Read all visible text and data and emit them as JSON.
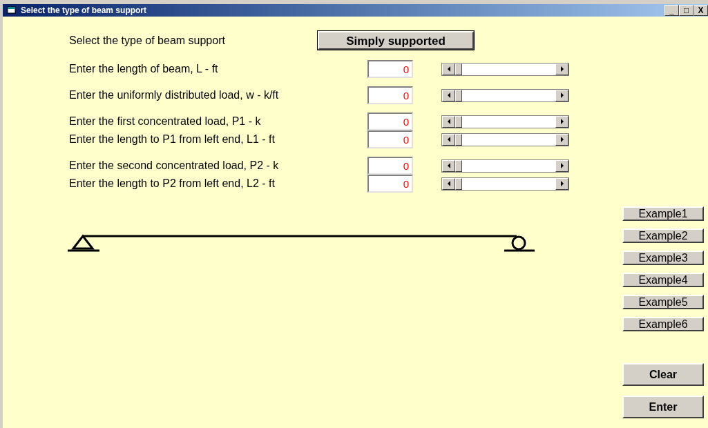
{
  "window": {
    "title": "Select the type of beam support",
    "controls": [
      "_",
      "□",
      "X"
    ]
  },
  "support": {
    "label": "Select the type of beam support",
    "button": "Simply supported"
  },
  "input_groups": [
    [
      {
        "label": "Enter the length of beam, L - ft",
        "value": "0"
      }
    ],
    [
      {
        "label": "Enter the uniformly distributed load, w - k/ft",
        "value": "0"
      }
    ],
    [
      {
        "label": "Enter the first concentrated load, P1 - k",
        "value": "0"
      },
      {
        "label": "Enter the length to P1 from left end, L1 - ft",
        "value": "0"
      }
    ],
    [
      {
        "label": "Enter the second concentrated load, P2 - k",
        "value": "0"
      },
      {
        "label": "Enter the length to P2 from left end, L2 - ft",
        "value": "0"
      }
    ]
  ],
  "example_buttons": [
    "Example1",
    "Example2",
    "Example3",
    "Example4",
    "Example5",
    "Example6"
  ],
  "action_buttons": [
    "Clear",
    "Enter"
  ]
}
